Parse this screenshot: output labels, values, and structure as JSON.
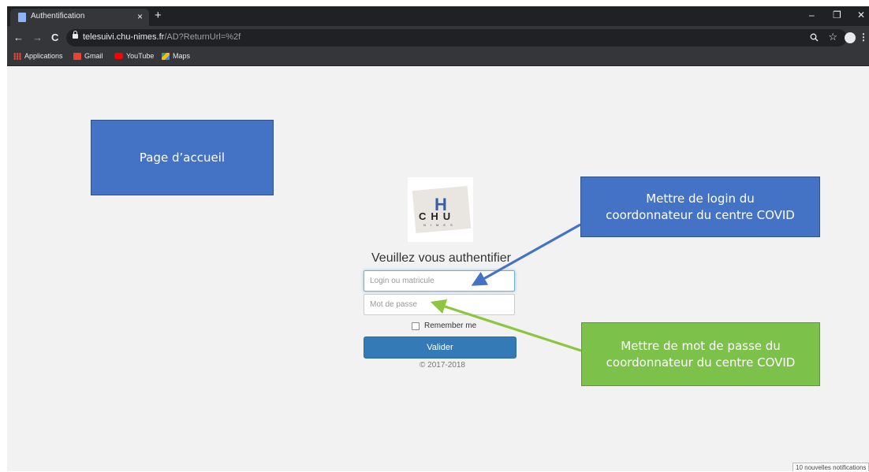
{
  "browser": {
    "tab_title": "Authentification",
    "tab_close": "×",
    "new_tab": "+",
    "window": {
      "minimize": "–",
      "maximize": "❐",
      "close": "✕"
    },
    "nav": {
      "back": "←",
      "forward": "→",
      "reload": "C"
    },
    "url_host": "telesuivi.chu-nimes.fr",
    "url_path": "/AD?ReturnUrl=%2f",
    "zoom_icon": "magnifier-icon",
    "star": "☆",
    "menu": "⋮",
    "bookmarks": [
      {
        "label": "Applications",
        "icon": "apps-grid-icon"
      },
      {
        "label": "Gmail",
        "icon": "gmail-icon"
      },
      {
        "label": "YouTube",
        "icon": "youtube-icon"
      },
      {
        "label": "Maps",
        "icon": "maps-icon"
      }
    ]
  },
  "page": {
    "logo": {
      "mark": "H",
      "text": "CHU",
      "sub": "NIMES"
    },
    "heading": "Veuillez vous authentifier",
    "login_placeholder": "Login ou matricule",
    "password_placeholder": "Mot de passe",
    "remember_label": "Remember me",
    "submit_label": "Valider",
    "copyright": "© 2017-2018"
  },
  "annotations": {
    "home": "Page d’accueil",
    "login": [
      "Mettre de login du",
      "coordonnateur du centre COVID"
    ],
    "password": [
      "Mettre de mot de passe du",
      "coordonnateur du centre COVID"
    ],
    "colors": {
      "blue": "#4472c4",
      "green": "#7cc24a"
    }
  },
  "notification": "10 nouvelles notifications"
}
